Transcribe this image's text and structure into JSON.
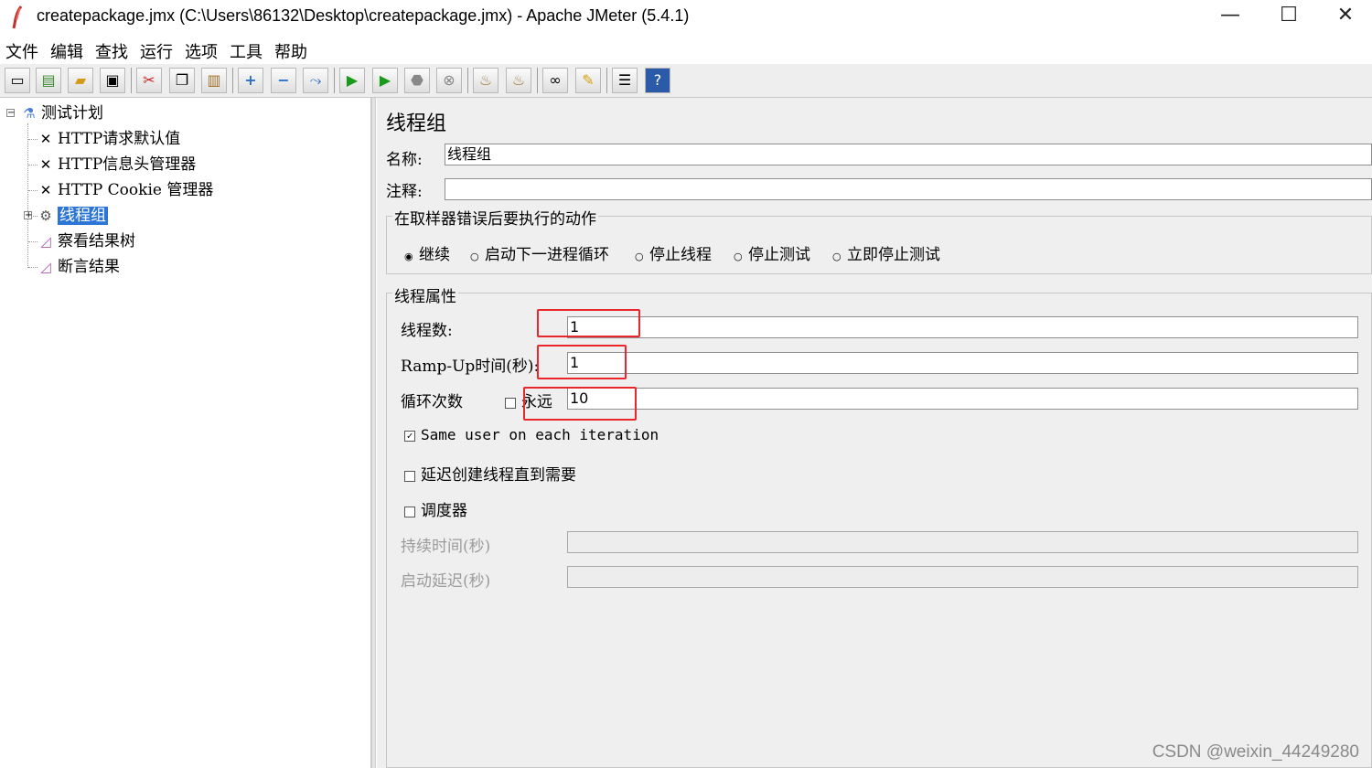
{
  "window": {
    "title": "createpackage.jmx (C:\\Users\\86132\\Desktop\\createpackage.jmx) - Apache JMeter (5.4.1)",
    "controls": [
      "—",
      "☐",
      "✕"
    ]
  },
  "menubar": {
    "items": [
      "文件",
      "编辑",
      "查找",
      "运行",
      "选项",
      "工具",
      "帮助"
    ]
  },
  "toolbar": {
    "buttons": [
      "new-icon",
      "templates-icon",
      "open-icon",
      "save-icon",
      "cut-icon",
      "copy-icon",
      "paste-icon",
      "expand-icon",
      "collapse-icon",
      "toggle-icon",
      "start-icon",
      "start-no-pause-icon",
      "stop-icon",
      "shutdown-icon",
      "clear-icon",
      "clear-all-icon",
      "search-icon",
      "reset-search-icon",
      "function-helper-icon",
      "help-icon"
    ]
  },
  "tree": {
    "root": "测试计划",
    "items": [
      {
        "label": "HTTP请求默认值",
        "icon": "wrench-icon"
      },
      {
        "label": "HTTP信息头管理器",
        "icon": "wrench-icon"
      },
      {
        "label": "HTTP Cookie 管理器",
        "icon": "wrench-icon"
      },
      {
        "label": "线程组",
        "icon": "gear-icon",
        "selected": true
      },
      {
        "label": "察看结果树",
        "icon": "graph-icon"
      },
      {
        "label": "断言结果",
        "icon": "graph-icon"
      }
    ]
  },
  "panel": {
    "title": "线程组",
    "name_label": "名称:",
    "name_value": "线程组",
    "comment_label": "注释:",
    "comment_value": "",
    "error_group": {
      "title": "在取样器错误后要执行的动作",
      "options": [
        "继续",
        "启动下一进程循环",
        "停止线程",
        "停止测试",
        "立即停止测试"
      ],
      "selected": "继续"
    },
    "thread_group": {
      "title": "线程属性",
      "threads_label": "线程数:",
      "threads_value": "1",
      "rampup_label": "Ramp-Up时间(秒):",
      "rampup_value": "1",
      "loop_label": "循环次数",
      "forever_label": "永远",
      "forever_checked": false,
      "loop_value": "10",
      "same_user_label": "Same user on each iteration",
      "same_user_checked": true,
      "delay_label": "延迟创建线程直到需要",
      "delay_checked": false,
      "scheduler_label": "调度器",
      "scheduler_checked": false,
      "duration_label": "持续时间(秒)",
      "duration_value": "",
      "startup_delay_label": "启动延迟(秒)",
      "startup_delay_value": ""
    }
  },
  "watermark": "CSDN @weixin_44249280",
  "colors": {
    "selection": "#2b75d6",
    "highlight_box": "#e8262b",
    "panel_bg": "#efefef"
  }
}
